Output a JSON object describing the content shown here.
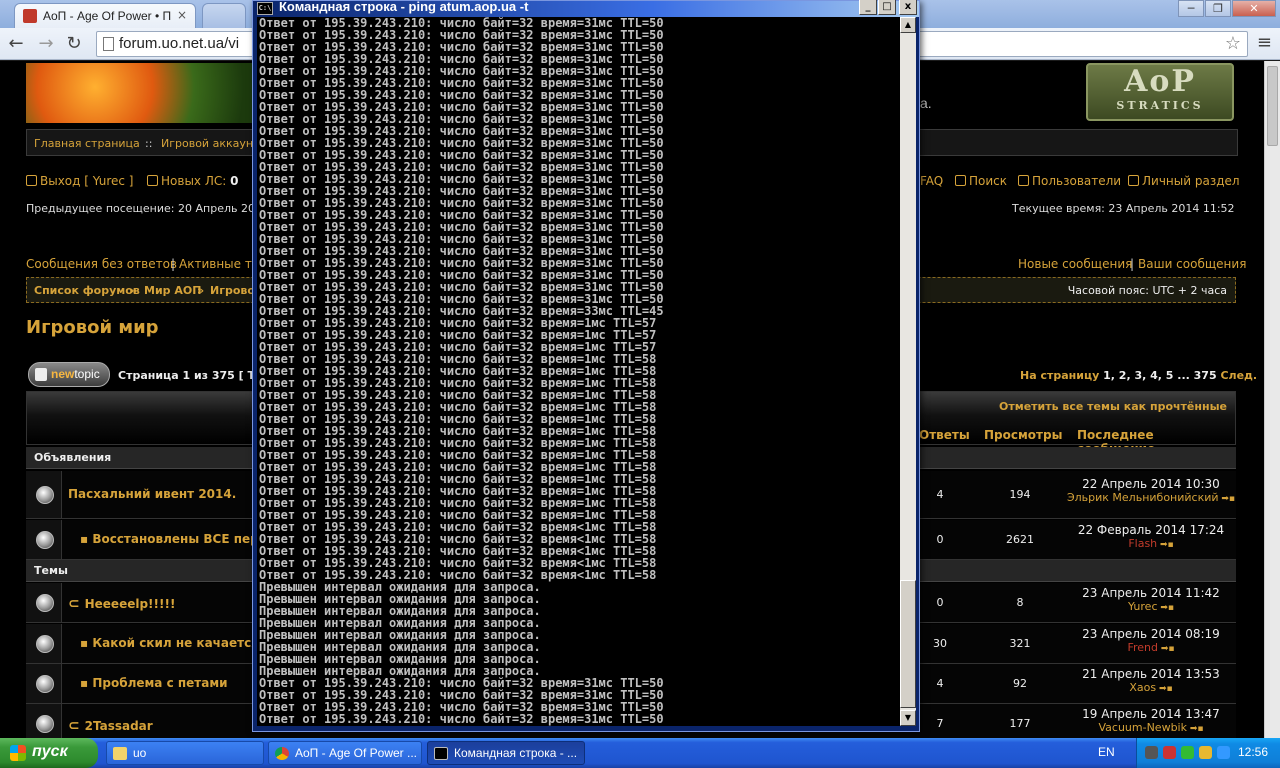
{
  "browser": {
    "tab_title": "АоП - Age Of Power • Просм",
    "tab_close": "×",
    "url": "forum.uo.net.ua/vi",
    "window_controls": [
      "─",
      "❐",
      "✕"
    ],
    "nav": {
      "back": "←",
      "forward": "→",
      "reload": "↻",
      "star": "☆",
      "menu": "≡"
    }
  },
  "forum": {
    "banner_tail": "а.",
    "logo_top": "AoP",
    "logo_bottom": "STRATICS",
    "nav_home": "Главная страница",
    "nav_sep": "::",
    "nav_account": "Игровой аккаун",
    "logout": "Выход [ Yurec ]",
    "new_pm_label": "Новых ЛС:",
    "new_pm_count": "0",
    "faq": "FAQ",
    "search": "Поиск",
    "members": "Пользователи",
    "ucp": "Личный раздел",
    "prev_visit": "Предыдущее посещение: 20 Апрель 20",
    "current_time": "Текущее время: 23 Апрель 2014 11:52",
    "unanswered": "Сообщения без ответов",
    "pipe": "|",
    "active_topics": "Активные те",
    "new_posts": "Новые сообщения",
    "your_posts": "Ваши сообщения",
    "crumb_1": "Список форумов",
    "crumb_sep": "»",
    "crumb_2": "Мир АОП",
    "crumb_3": "Игровой",
    "timezone": "Часовой пояс: UTC + 2 часа",
    "title": "Игровой мир",
    "newtopic_a": "new",
    "newtopic_b": "topic",
    "page_info": "Страница 1 из 375  [ Те",
    "goto_label": "На страницу",
    "pages": "1, 2, 3, 4, 5 ... 375",
    "next": "След.",
    "mark_all": "Отметить все темы как прочтённые",
    "col_replies": "Ответы",
    "col_views": "Просмотры",
    "col_last": "Последнее сообщение",
    "sec_announce": "Объявления",
    "sec_topics": "Темы",
    "rows": [
      {
        "title": "Пасхальний ивент 2014.",
        "replies": "4",
        "views": "194",
        "date": "22 Апрель 2014 10:30",
        "author": "Эльрик Мельнибонийский",
        "red": false,
        "sub": false,
        "clip": false
      },
      {
        "title": "Восстановлены ВСЕ персо",
        "replies": "0",
        "views": "2621",
        "date": "22 Февраль 2014 17:24",
        "author": "Flash",
        "red": true,
        "sub": true,
        "clip": false
      },
      {
        "title": "Heeeeelp!!!!!",
        "replies": "0",
        "views": "8",
        "date": "23 Апрель 2014 11:42",
        "author": "Yurec",
        "red": false,
        "sub": false,
        "clip": true
      },
      {
        "title": "Какой скил не качается?",
        "replies": "30",
        "views": "321",
        "date": "23 Апрель 2014 08:19",
        "author": "Frend",
        "red": true,
        "sub": true,
        "clip": false
      },
      {
        "title": "Проблема с петами",
        "replies": "4",
        "views": "92",
        "date": "21 Апрель 2014 13:53",
        "author": "Xaos",
        "red": false,
        "sub": true,
        "clip": false
      },
      {
        "title": "2Tassadar",
        "replies": "7",
        "views": "177",
        "date": "19 Апрель 2014 13:47",
        "author": "Vacuum-Newbik",
        "red": false,
        "sub": false,
        "clip": true
      }
    ]
  },
  "cmd": {
    "icon_text": "C:\\",
    "title": "Командная строка - ping atum.aop.ua -t",
    "buttons": [
      "_",
      "□",
      "x"
    ],
    "up": "▲",
    "down": "▼",
    "lines": [
      "Ответ от 195.39.243.210: число байт=32 время=31мс TTL=50",
      "Ответ от 195.39.243.210: число байт=32 время=31мс TTL=50",
      "Ответ от 195.39.243.210: число байт=32 время=31мс TTL=50",
      "Ответ от 195.39.243.210: число байт=32 время=31мс TTL=50",
      "Ответ от 195.39.243.210: число байт=32 время=31мс TTL=50",
      "Ответ от 195.39.243.210: число байт=32 время=31мс TTL=50",
      "Ответ от 195.39.243.210: число байт=32 время=31мс TTL=50",
      "Ответ от 195.39.243.210: число байт=32 время=31мс TTL=50",
      "Ответ от 195.39.243.210: число байт=32 время=31мс TTL=50",
      "Ответ от 195.39.243.210: число байт=32 время=31мс TTL=50",
      "Ответ от 195.39.243.210: число байт=32 время=31мс TTL=50",
      "Ответ от 195.39.243.210: число байт=32 время=31мс TTL=50",
      "Ответ от 195.39.243.210: число байт=32 время=31мс TTL=50",
      "Ответ от 195.39.243.210: число байт=32 время=31мс TTL=50",
      "Ответ от 195.39.243.210: число байт=32 время=31мс TTL=50",
      "Ответ от 195.39.243.210: число байт=32 время=31мс TTL=50",
      "Ответ от 195.39.243.210: число байт=32 время=31мс TTL=50",
      "Ответ от 195.39.243.210: число байт=32 время=31мс TTL=50",
      "Ответ от 195.39.243.210: число байт=32 время=31мс TTL=50",
      "Ответ от 195.39.243.210: число байт=32 время=31мс TTL=50",
      "Ответ от 195.39.243.210: число байт=32 время=31мс TTL=50",
      "Ответ от 195.39.243.210: число байт=32 время=31мс TTL=50",
      "Ответ от 195.39.243.210: число байт=32 время=31мс TTL=50",
      "Ответ от 195.39.243.210: число байт=32 время=31мс TTL=50",
      "Ответ от 195.39.243.210: число байт=32 время=33мс TTL=45",
      "Ответ от 195.39.243.210: число байт=32 время=1мс TTL=57",
      "Ответ от 195.39.243.210: число байт=32 время=1мс TTL=57",
      "Ответ от 195.39.243.210: число байт=32 время=1мс TTL=57",
      "Ответ от 195.39.243.210: число байт=32 время=1мс TTL=58",
      "Ответ от 195.39.243.210: число байт=32 время=1мс TTL=58",
      "Ответ от 195.39.243.210: число байт=32 время=1мс TTL=58",
      "Ответ от 195.39.243.210: число байт=32 время=1мс TTL=58",
      "Ответ от 195.39.243.210: число байт=32 время=1мс TTL=58",
      "Ответ от 195.39.243.210: число байт=32 время=1мс TTL=58",
      "Ответ от 195.39.243.210: число байт=32 время=1мс TTL=58",
      "Ответ от 195.39.243.210: число байт=32 время=1мс TTL=58",
      "Ответ от 195.39.243.210: число байт=32 время=1мс TTL=58",
      "Ответ от 195.39.243.210: число байт=32 время=1мс TTL=58",
      "Ответ от 195.39.243.210: число байт=32 время=1мс TTL=58",
      "Ответ от 195.39.243.210: число байт=32 время=1мс TTL=58",
      "Ответ от 195.39.243.210: число байт=32 время=1мс TTL=58",
      "Ответ от 195.39.243.210: число байт=32 время=1мс TTL=58",
      "Ответ от 195.39.243.210: число байт=32 время<1мс TTL=58",
      "Ответ от 195.39.243.210: число байт=32 время<1мс TTL=58",
      "Ответ от 195.39.243.210: число байт=32 время<1мс TTL=58",
      "Ответ от 195.39.243.210: число байт=32 время<1мс TTL=58",
      "Ответ от 195.39.243.210: число байт=32 время<1мс TTL=58",
      "Превышен интервал ожидания для запроса.",
      "Превышен интервал ожидания для запроса.",
      "Превышен интервал ожидания для запроса.",
      "Превышен интервал ожидания для запроса.",
      "Превышен интервал ожидания для запроса.",
      "Превышен интервал ожидания для запроса.",
      "Превышен интервал ожидания для запроса.",
      "Превышен интервал ожидания для запроса.",
      "Ответ от 195.39.243.210: число байт=32 время=31мс TTL=50",
      "Ответ от 195.39.243.210: число байт=32 время=31мс TTL=50",
      "Ответ от 195.39.243.210: число байт=32 время=31мс TTL=50",
      "Ответ от 195.39.243.210: число байт=32 время=31мс TTL=50"
    ]
  },
  "taskbar": {
    "start": "пуск",
    "tasks": [
      "uo",
      "АоП - Age Of Power ...",
      "Командная строка - ..."
    ],
    "lang": "EN",
    "clock": "12:56"
  }
}
